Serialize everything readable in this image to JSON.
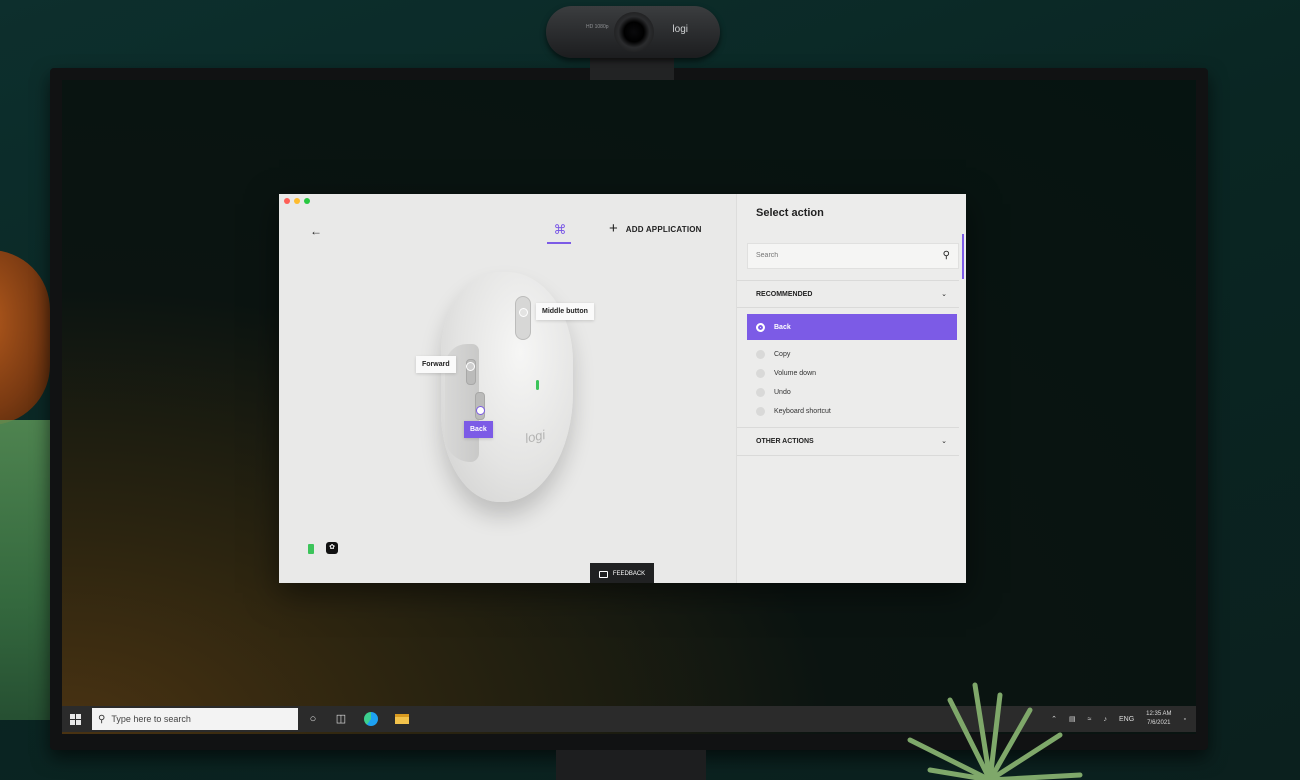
{
  "webcam": {
    "brand": "logi",
    "model_tag": "HD 1080p"
  },
  "app": {
    "window_dots": [
      "#fe5f57",
      "#febc2e",
      "#28c840"
    ],
    "accent": "#7c5be6",
    "toolbar": {
      "back_icon": "arrow-left-icon",
      "apps_icon": "all-applications-icon",
      "add_application_label": "ADD APPLICATION"
    },
    "mouse": {
      "brand": "logi",
      "callouts": {
        "middle": "Middle button",
        "forward": "Forward",
        "back": "Back"
      },
      "selected_button": "Back"
    },
    "feedback_label": "FEEDBACK",
    "panel": {
      "title": "Select action",
      "search_placeholder": "Search",
      "recommended_label": "RECOMMENDED",
      "selected_action": "Back",
      "actions": [
        "Copy",
        "Volume down",
        "Undo",
        "Keyboard shortcut"
      ],
      "other_actions_label": "OTHER ACTIONS"
    }
  },
  "taskbar": {
    "search_placeholder": "Type here to search",
    "language": "ENG",
    "time": "12:35 AM",
    "date": "7/6/2021"
  }
}
